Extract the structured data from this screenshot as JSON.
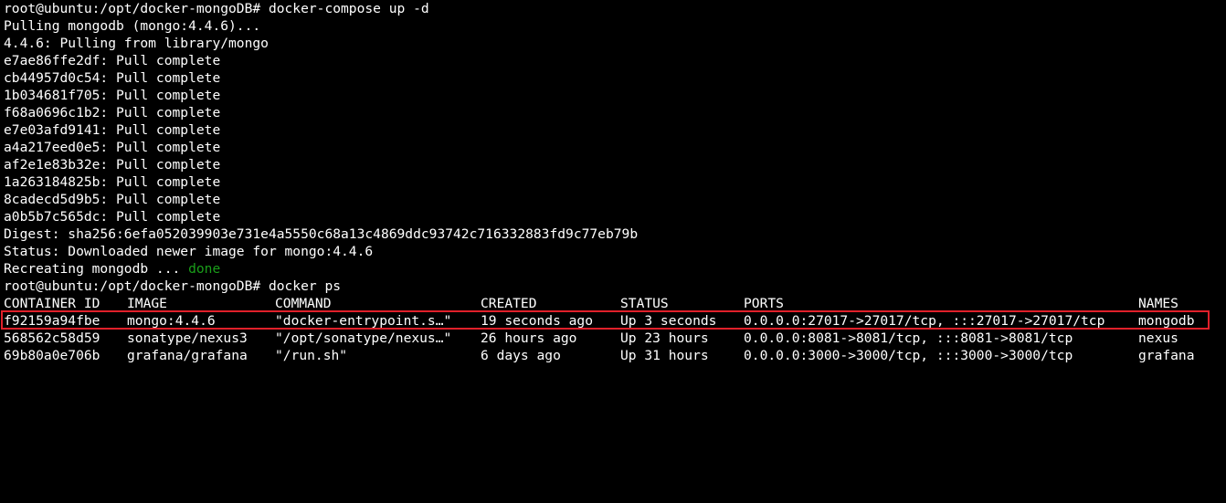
{
  "terminal": {
    "lines": [
      "root@ubuntu:/opt/docker-mongoDB# docker-compose up -d",
      "Pulling mongodb (mongo:4.4.6)...",
      "4.4.6: Pulling from library/mongo",
      "e7ae86ffe2df: Pull complete",
      "cb44957d0c54: Pull complete",
      "1b034681f705: Pull complete",
      "f68a0696c1b2: Pull complete",
      "e7e03afd9141: Pull complete",
      "a4a217eed0e5: Pull complete",
      "af2e1e83b32e: Pull complete",
      "1a263184825b: Pull complete",
      "8cadecd5d9b5: Pull complete",
      "a0b5b7c565dc: Pull complete",
      "Digest: sha256:6efa052039903e731e4a5550c68a13c4869ddc93742c716332883fd9c77eb79b",
      "Status: Downloaded newer image for mongo:4.4.6"
    ],
    "recreating_prefix": "Recreating mongodb ... ",
    "recreating_status": "done",
    "ps_command": "root@ubuntu:/opt/docker-mongoDB# docker ps",
    "table": {
      "headers": [
        "CONTAINER ID",
        "IMAGE",
        "COMMAND",
        "CREATED",
        "STATUS",
        "PORTS",
        "NAMES"
      ],
      "rows": [
        [
          "f92159a94fbe",
          "mongo:4.4.6",
          "\"docker-entrypoint.s…\"",
          "19 seconds ago",
          "Up 3 seconds",
          "0.0.0.0:27017->27017/tcp, :::27017->27017/tcp",
          "mongodb"
        ],
        [
          "568562c58d59",
          "sonatype/nexus3",
          "\"/opt/sonatype/nexus…\"",
          "26 hours ago",
          "Up 23 hours",
          "0.0.0.0:8081->8081/tcp, :::8081->8081/tcp",
          "nexus"
        ],
        [
          "69b80a0e706b",
          "grafana/grafana",
          "\"/run.sh\"",
          "6 days ago",
          "Up 31 hours",
          "0.0.0.0:3000->3000/tcp, :::3000->3000/tcp",
          "grafana"
        ]
      ]
    },
    "highlight_color": "#e0202a",
    "done_color": "#1a9e1a"
  }
}
